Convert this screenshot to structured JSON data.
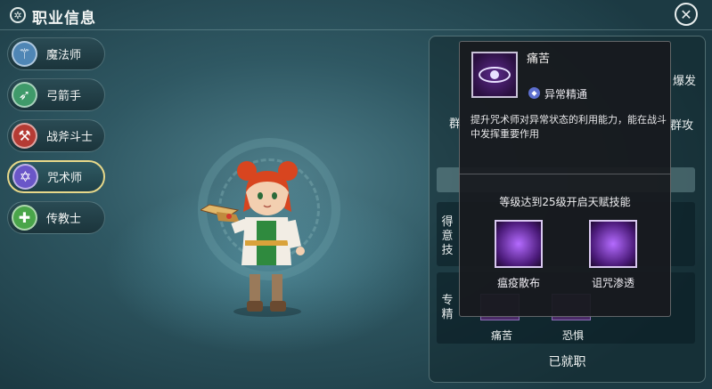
{
  "header": {
    "title": "职业信息",
    "title_icon": "gear-icon",
    "close_icon": "close-icon"
  },
  "classes": [
    {
      "label": "魔法师",
      "icon": "staff-icon",
      "color": "#4f86b5",
      "active": false
    },
    {
      "label": "弓箭手",
      "icon": "bow-icon",
      "color": "#3f9a6a",
      "active": false
    },
    {
      "label": "战斧斗士",
      "icon": "axe-icon",
      "color": "#b53b34",
      "active": false
    },
    {
      "label": "咒术师",
      "icon": "hex-icon",
      "color": "#6a56c8",
      "active": true
    },
    {
      "label": "传教士",
      "icon": "cross-icon",
      "color": "#4aa54a",
      "active": false
    }
  ],
  "panel": {
    "right_top": "爆发",
    "left_mid": "群",
    "right_mid": "群攻",
    "row1_label": "得意技",
    "row2_label": "专精",
    "skill1_label": "痛苦",
    "skill2_label": "恐惧",
    "status": "已就职"
  },
  "tooltip": {
    "skill_name": "痛苦",
    "skill_icon": "eye-icon",
    "tag": "异常精通",
    "description": "提升咒术师对异常状态的利用能力，能在战斗中发挥重要作用",
    "unlock_text": "等级达到25级开启天赋技能",
    "talents": [
      {
        "label": "瘟疫散布",
        "icon": "plague-icon"
      },
      {
        "label": "诅咒渗透",
        "icon": "curse-icon"
      }
    ]
  }
}
